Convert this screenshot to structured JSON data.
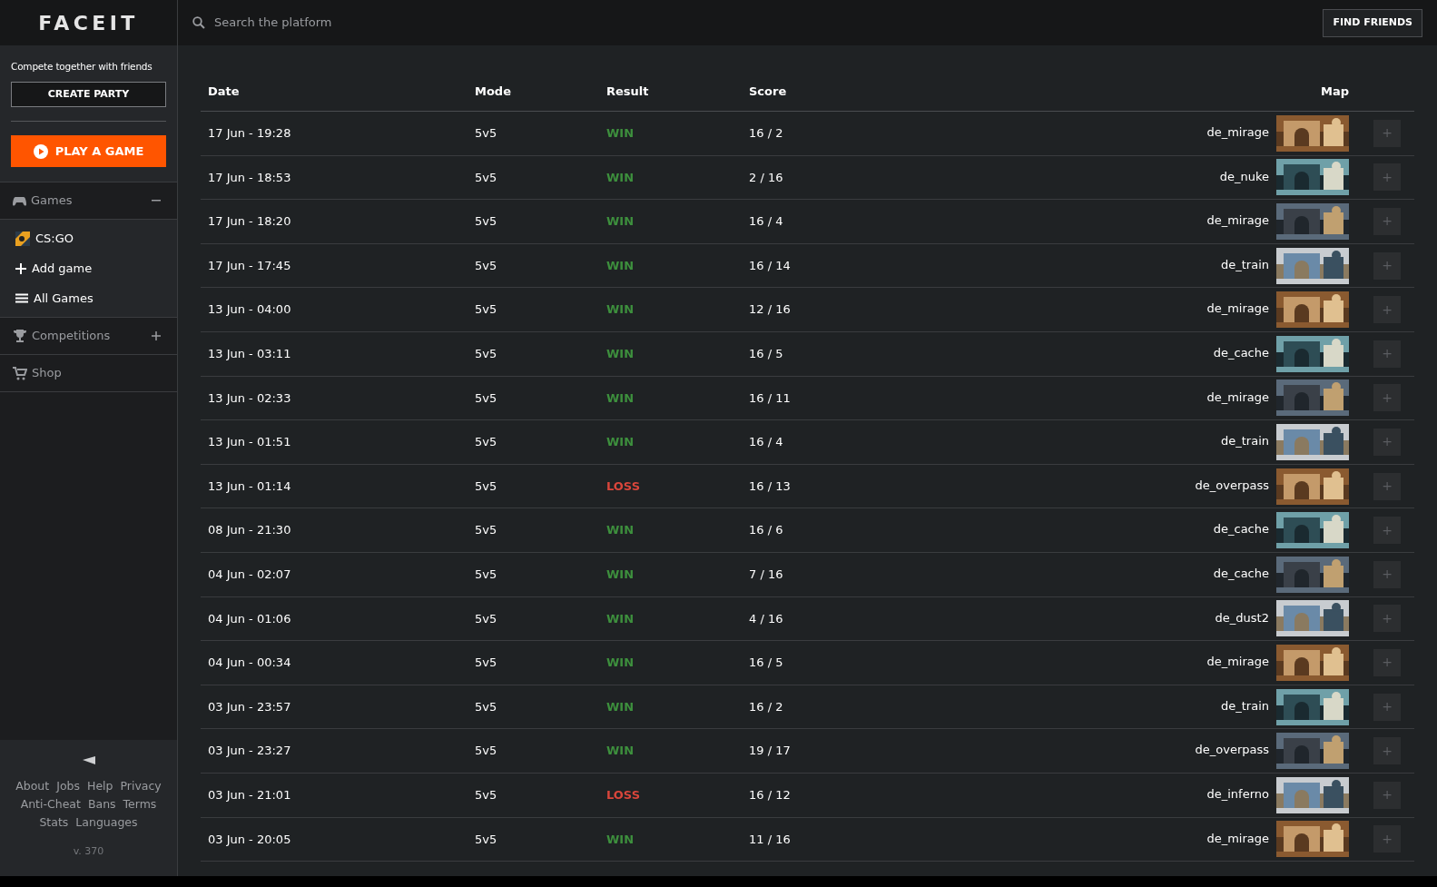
{
  "logo": "FACEIT",
  "search": {
    "placeholder": "Search the platform"
  },
  "find_friends": "FIND FRIENDS",
  "sidebar": {
    "tagline": "Compete together with friends",
    "create_party": "CREATE PARTY",
    "play": "PLAY A GAME",
    "sections": [
      {
        "kind": "games",
        "label": "Games",
        "expanded": true,
        "children": [
          {
            "kind": "game",
            "label": "CS:GO"
          },
          {
            "kind": "add",
            "label": "Add game"
          },
          {
            "kind": "all",
            "label": "All Games"
          }
        ]
      },
      {
        "kind": "competitions",
        "label": "Competitions",
        "expanded": false
      },
      {
        "kind": "shop",
        "label": "Shop"
      }
    ],
    "footer_links": [
      "About",
      "Jobs",
      "Help",
      "Privacy",
      "Anti-Cheat",
      "Bans",
      "Terms",
      "Stats",
      "Languages"
    ],
    "version": "v. 370"
  },
  "table": {
    "columns": [
      "Date",
      "Mode",
      "Result",
      "Score",
      "Map"
    ],
    "rows": [
      {
        "date": "17 Jun - 19:28",
        "mode": "5v5",
        "result": "WIN",
        "won": true,
        "score": "16 / 2",
        "map": "de_mirage"
      },
      {
        "date": "17 Jun - 18:53",
        "mode": "5v5",
        "result": "WIN",
        "won": true,
        "score": "2 / 16",
        "map": "de_nuke"
      },
      {
        "date": "17 Jun - 18:20",
        "mode": "5v5",
        "result": "WIN",
        "won": true,
        "score": "16 / 4",
        "map": "de_mirage"
      },
      {
        "date": "17 Jun - 17:45",
        "mode": "5v5",
        "result": "WIN",
        "won": true,
        "score": "16 / 14",
        "map": "de_train"
      },
      {
        "date": "13 Jun - 04:00",
        "mode": "5v5",
        "result": "WIN",
        "won": true,
        "score": "12 / 16",
        "map": "de_mirage"
      },
      {
        "date": "13 Jun - 03:11",
        "mode": "5v5",
        "result": "WIN",
        "won": true,
        "score": "16 / 5",
        "map": "de_cache"
      },
      {
        "date": "13 Jun - 02:33",
        "mode": "5v5",
        "result": "WIN",
        "won": true,
        "score": "16 / 11",
        "map": "de_mirage"
      },
      {
        "date": "13 Jun - 01:51",
        "mode": "5v5",
        "result": "WIN",
        "won": true,
        "score": "16 / 4",
        "map": "de_train"
      },
      {
        "date": "13 Jun - 01:14",
        "mode": "5v5",
        "result": "LOSS",
        "won": false,
        "score": "16 / 13",
        "map": "de_overpass"
      },
      {
        "date": "08 Jun - 21:30",
        "mode": "5v5",
        "result": "WIN",
        "won": true,
        "score": "16 / 6",
        "map": "de_cache"
      },
      {
        "date": "04 Jun - 02:07",
        "mode": "5v5",
        "result": "WIN",
        "won": true,
        "score": "7 / 16",
        "map": "de_cache"
      },
      {
        "date": "04 Jun - 01:06",
        "mode": "5v5",
        "result": "WIN",
        "won": true,
        "score": "4 / 16",
        "map": "de_dust2"
      },
      {
        "date": "04 Jun - 00:34",
        "mode": "5v5",
        "result": "WIN",
        "won": true,
        "score": "16 / 5",
        "map": "de_mirage"
      },
      {
        "date": "03 Jun - 23:57",
        "mode": "5v5",
        "result": "WIN",
        "won": true,
        "score": "16 / 2",
        "map": "de_train"
      },
      {
        "date": "03 Jun - 23:27",
        "mode": "5v5",
        "result": "WIN",
        "won": true,
        "score": "19 / 17",
        "map": "de_overpass"
      },
      {
        "date": "03 Jun - 21:01",
        "mode": "5v5",
        "result": "LOSS",
        "won": false,
        "score": "16 / 12",
        "map": "de_inferno"
      },
      {
        "date": "03 Jun - 20:05",
        "mode": "5v5",
        "result": "WIN",
        "won": true,
        "score": "11 / 16",
        "map": "de_mirage"
      }
    ],
    "add_button": "+"
  }
}
